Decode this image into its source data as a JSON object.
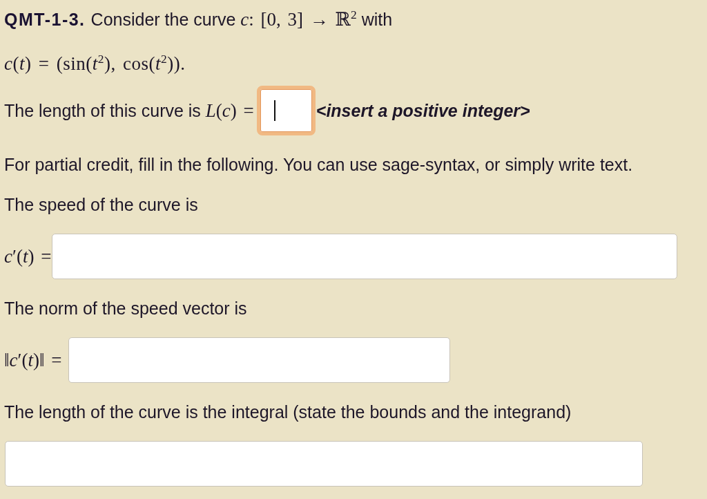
{
  "question": {
    "number": "QMT-1-3.",
    "statement": {
      "text": "Consider the curve",
      "math": "*c*: [0, 3] → ℝ$^{2}$",
      "text_after": "with"
    },
    "formula": "*c*(*t*) = (sin(*t*$^{2}$), cos(*t*$^{2}$))."
  },
  "answer": {
    "label_text": "The length of this curve is",
    "label_math": "*L*(*c*) =",
    "focused": true,
    "hint": "<insert a positive integer>"
  },
  "partial_credit": {
    "intro": "For partial credit, fill in the following. You can use sage-syntax, or simply write text.",
    "parts": [
      {
        "prompt": "The speed of the curve is",
        "label": "*c*′(*t*) =",
        "kind": "wide"
      },
      {
        "prompt": "The norm of the speed vector is",
        "label": "‖*c*′(*t*)‖ =",
        "kind": "medium"
      },
      {
        "prompt": "The length of the curve is the integral (state the bounds and the integrand)",
        "kind": "block"
      }
    ]
  }
}
